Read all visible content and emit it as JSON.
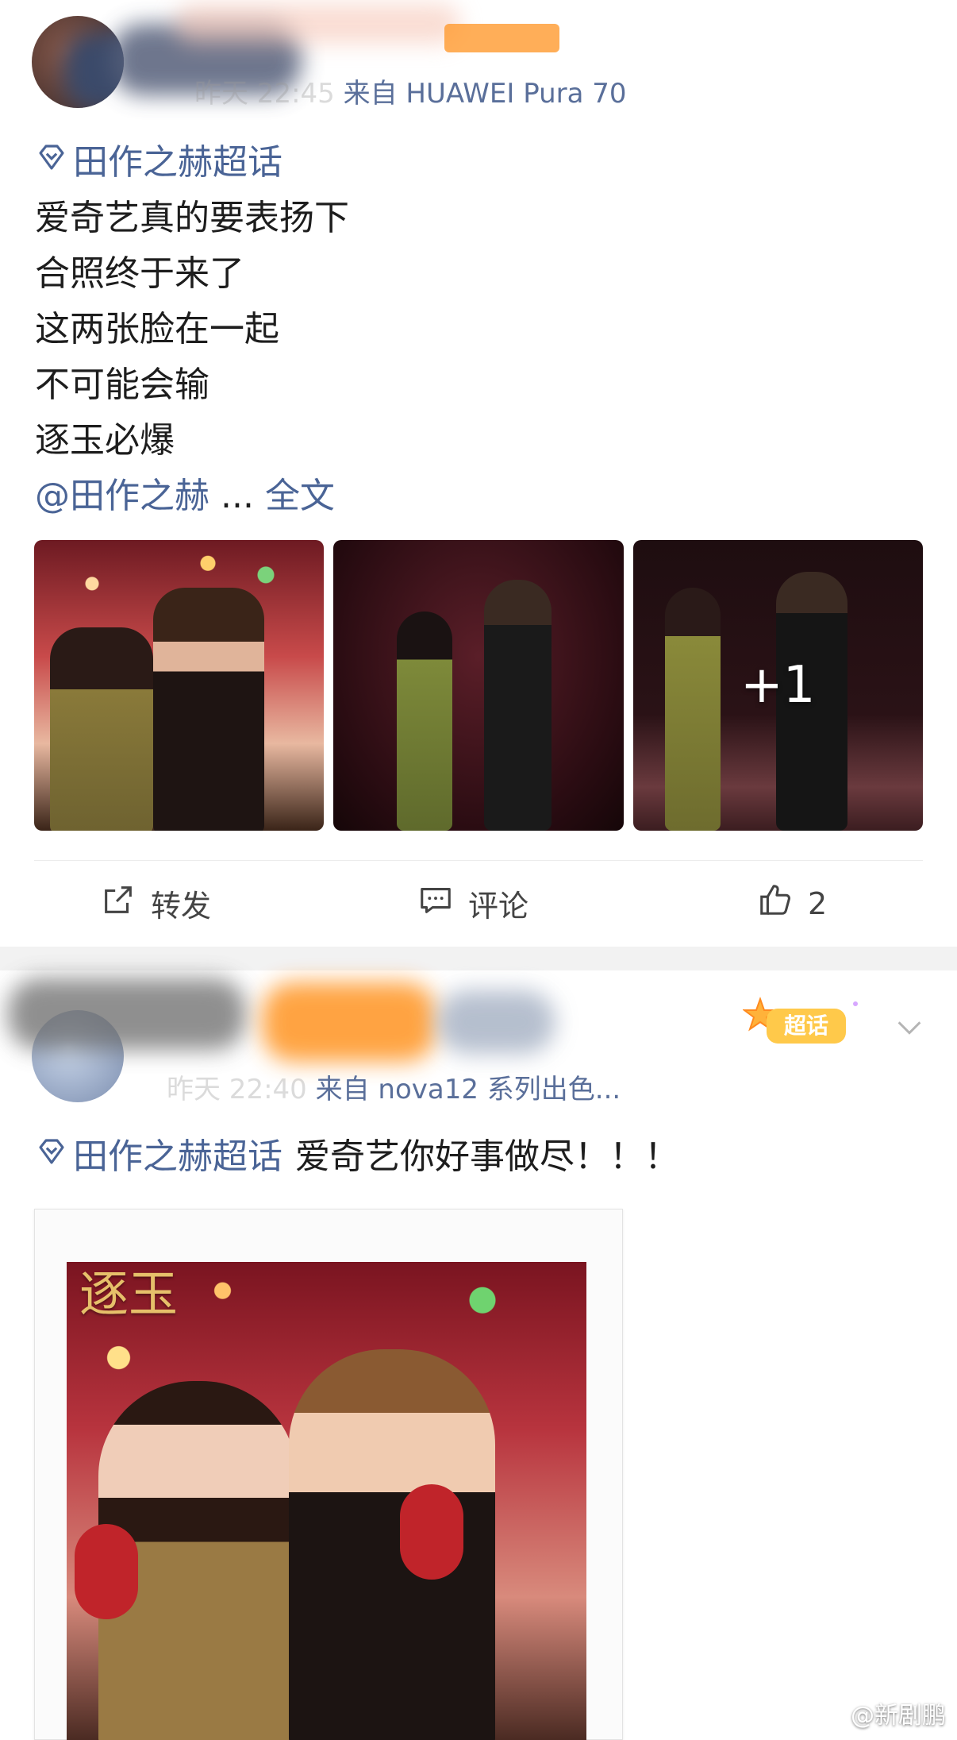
{
  "post1": {
    "meta_time": "昨天 22:45",
    "meta_source": "来自 HUAWEI Pura 70",
    "topic": "田作之赫超话",
    "lines": [
      "爱奇艺真的要表扬下",
      "合照终于来了",
      "这两张脸在一起",
      "不可能会输",
      "逐玉必爆"
    ],
    "mention": "@田作之赫",
    "ellipsis": " ... ",
    "fulltext": "全文",
    "more_photos": "+1",
    "actions": {
      "repost": "转发",
      "comment": "评论",
      "like_count": "2"
    }
  },
  "post2": {
    "meta_time": "昨天 22:40",
    "meta_source": "来自 nova12 系列出色...",
    "supertopic_badge": "超话",
    "topic": "田作之赫超话",
    "text": "爱奇艺你好事做尽！！！",
    "poster_title": "逐玉",
    "watermark": "@新剧鹏"
  },
  "icons": {
    "topic": "diamond-topic-icon",
    "repost": "share-out-icon",
    "comment": "comment-bubble-icon",
    "like": "thumbs-up-icon",
    "chevron": "chevron-down-icon"
  },
  "colors": {
    "link": "#4a6496",
    "meta": "#9a9a9a",
    "badge": "#ff9a2e"
  }
}
